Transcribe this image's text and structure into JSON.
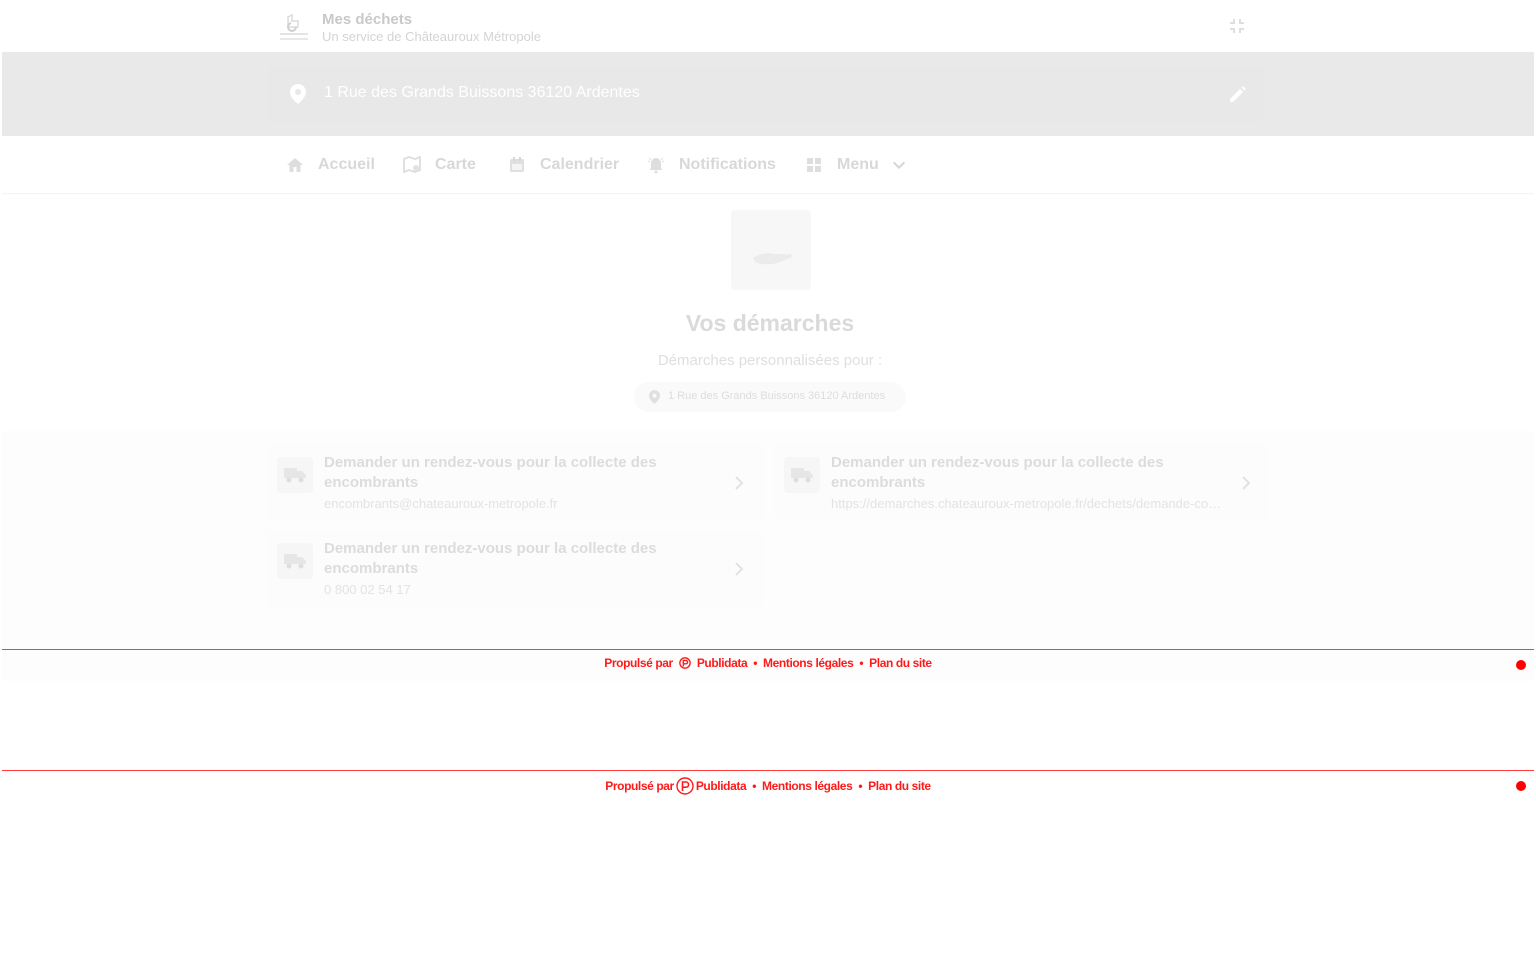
{
  "header": {
    "title": "Mes déchets",
    "subtitle": "Un service de Châteauroux Métropole"
  },
  "address": {
    "value": "1 Rue des Grands Buissons 36120 Ardentes"
  },
  "nav": {
    "items": [
      {
        "label": "Accueil"
      },
      {
        "label": "Carte"
      },
      {
        "label": "Calendrier"
      },
      {
        "label": "Notifications"
      },
      {
        "label": "Menu"
      }
    ]
  },
  "hero": {
    "title": "Vos démarches",
    "subtitle": "Démarches personnalisées pour :",
    "chip": "1 Rue des Grands Buissons 36120 Ardentes"
  },
  "cards": [
    {
      "title": "Demander un rendez-vous pour la collecte des encombrants",
      "subtitle": "encombrants@chateauroux-metropole.fr"
    },
    {
      "title": "Demander un rendez-vous pour la collecte des encombrants",
      "subtitle": "https://demarches.chateauroux-metropole.fr/dechets/demande-collecte-encombrants"
    },
    {
      "title": "Demander un rendez-vous pour la collecte des encombrants",
      "subtitle": "0 800 02 54 17"
    }
  ],
  "footer": {
    "powered_by": "Propulsé par",
    "brand": "Publidata",
    "legal": "Mentions légales",
    "sitemap": "Plan du site",
    "separator": "•"
  },
  "colors": {
    "accent": "#ff0000",
    "band": "#e9e9e9"
  }
}
